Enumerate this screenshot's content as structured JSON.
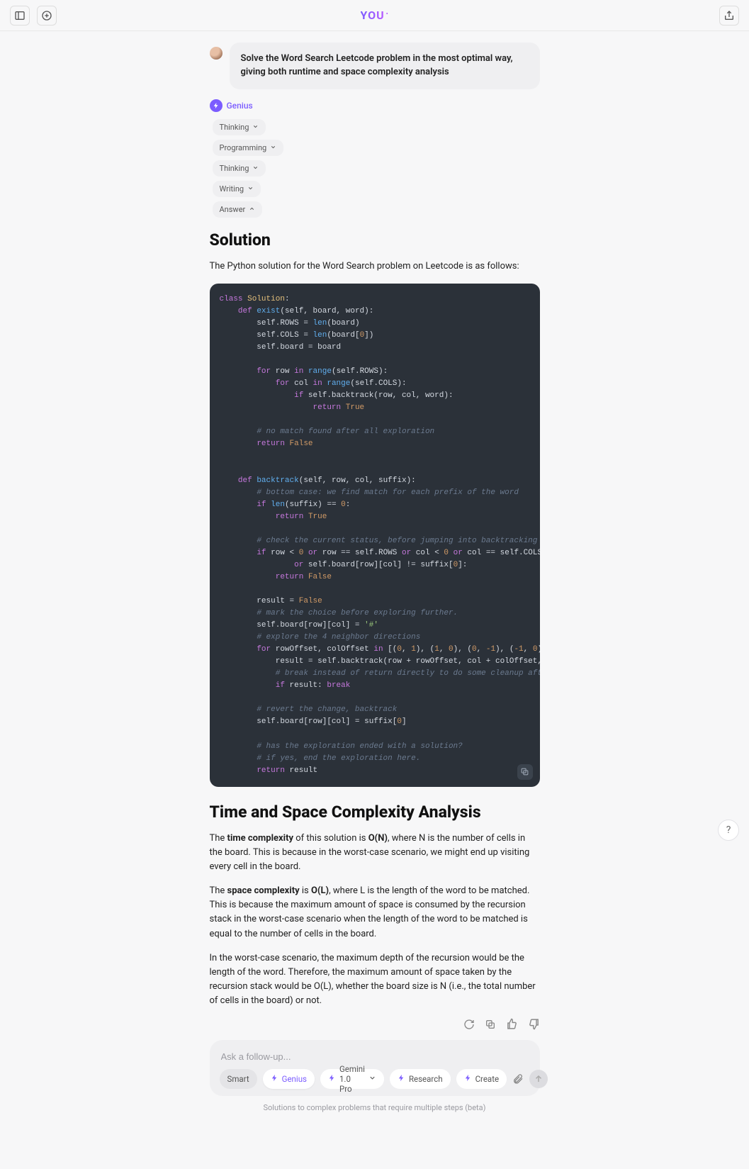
{
  "header": {
    "logo_text": "YOU",
    "logo_suffix": "•"
  },
  "user_message": "Solve the Word Search Leetcode problem in the most optimal way, giving both runtime and space complexity analysis",
  "assistant_label": "Genius",
  "chips": [
    {
      "label": "Thinking",
      "dir": "down"
    },
    {
      "label": "Programming",
      "dir": "down"
    },
    {
      "label": "Thinking",
      "dir": "down"
    },
    {
      "label": "Writing",
      "dir": "down"
    },
    {
      "label": "Answer",
      "dir": "up"
    }
  ],
  "solution": {
    "heading": "Solution",
    "intro": "The Python solution for the Word Search problem on Leetcode is as follows:"
  },
  "complexity": {
    "heading": "Time and Space Complexity Analysis",
    "p1_a": "The ",
    "p1_b": "time complexity",
    "p1_c": " of this solution is ",
    "p1_d": "O(N)",
    "p1_e": ", where N is the number of cells in the board. This is because in the worst-case scenario, we might end up visiting every cell in the board.",
    "p2_a": "The ",
    "p2_b": "space complexity",
    "p2_c": " is ",
    "p2_d": "O(L)",
    "p2_e": ", where L is the length of the word to be matched. This is because the maximum amount of space is consumed by the recursion stack in the worst-case scenario when the length of the word to be matched is equal to the number of cells in the board.",
    "p3": "In the worst-case scenario, the maximum depth of the recursion would be the length of the word. Therefore, the maximum amount of space taken by the recursion stack would be O(L), whether the board size is N (i.e., the total number of cells in the board) or not."
  },
  "composer": {
    "placeholder": "Ask a follow-up...",
    "modes": [
      {
        "label": "Smart",
        "style": "plain"
      },
      {
        "label": "Genius",
        "style": "active",
        "icon": "bolt"
      },
      {
        "label": "Gemini 1.0 Pro",
        "style": "white",
        "icon": "bolt",
        "chevron": true
      },
      {
        "label": "Research",
        "style": "white",
        "icon": "bolt"
      },
      {
        "label": "Create",
        "style": "white",
        "icon": "bolt"
      }
    ]
  },
  "footnote": "Solutions to complex problems that require multiple steps (beta)",
  "help": "?"
}
